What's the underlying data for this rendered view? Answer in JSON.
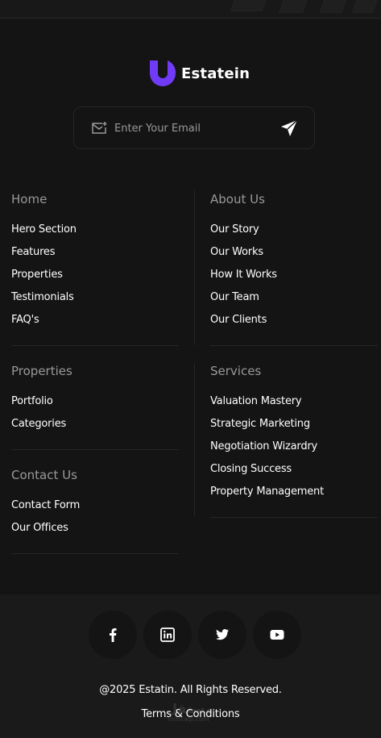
{
  "brand": {
    "name": "Estatein",
    "accent": "#703BF7"
  },
  "newsletter": {
    "placeholder": "Enter Your Email"
  },
  "columns": {
    "home": {
      "title": "Home",
      "links": [
        "Hero Section",
        "Features",
        "Properties",
        "Testimonials",
        "FAQ's"
      ]
    },
    "about": {
      "title": "About Us",
      "links": [
        "Our Story",
        "Our Works",
        "How It Works",
        "Our Team",
        "Our Clients"
      ]
    },
    "properties": {
      "title": "Properties",
      "links": [
        "Portfolio",
        "Categories"
      ]
    },
    "services": {
      "title": "Services",
      "links": [
        "Valuation Mastery",
        "Strategic Marketing",
        "Negotiation Wizardry",
        "Closing Success",
        "Property Management"
      ]
    },
    "contact": {
      "title": "Contact Us",
      "links": [
        "Contact Form",
        "Our Offices"
      ]
    }
  },
  "social": [
    "facebook-icon",
    "linkedin-icon",
    "twitter-icon",
    "youtube-icon"
  ],
  "bottom": {
    "copyright": "@2025 Estatin. All Rights Reserved.",
    "terms": "Terms & Conditions",
    "watermark": "مستقل",
    "watermark_sub": "mostaql.com"
  }
}
